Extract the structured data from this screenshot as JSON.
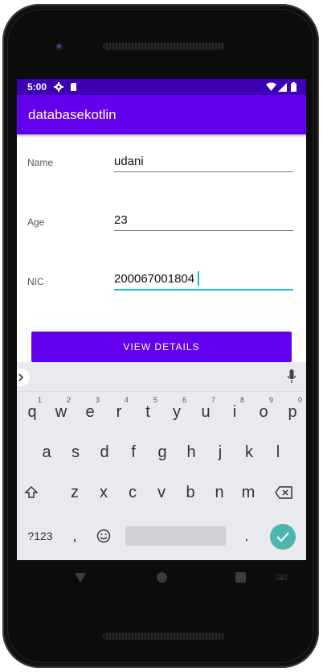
{
  "status": {
    "time": "5:00"
  },
  "app": {
    "title": "databasekotlin"
  },
  "form": {
    "name_label": "Name",
    "name_value": "udani",
    "age_label": "Age",
    "age_value": "23",
    "nic_label": "NIC",
    "nic_value": "200067001804",
    "button_label": "VIEW DETAILS"
  },
  "keyboard": {
    "row1": [
      {
        "key": "q",
        "hint": "1"
      },
      {
        "key": "w",
        "hint": "2"
      },
      {
        "key": "e",
        "hint": "3"
      },
      {
        "key": "r",
        "hint": "4"
      },
      {
        "key": "t",
        "hint": "5"
      },
      {
        "key": "y",
        "hint": "6"
      },
      {
        "key": "u",
        "hint": "7"
      },
      {
        "key": "i",
        "hint": "8"
      },
      {
        "key": "o",
        "hint": "9"
      },
      {
        "key": "p",
        "hint": "0"
      }
    ],
    "row2": [
      "a",
      "s",
      "d",
      "f",
      "g",
      "h",
      "j",
      "k",
      "l"
    ],
    "row3": [
      "z",
      "x",
      "c",
      "v",
      "b",
      "n",
      "m"
    ],
    "symbols_label": "?123",
    "comma": ",",
    "period": ".",
    "accent_color": "#4db6ac"
  },
  "colors": {
    "appbar": "#6200ee",
    "statusbar": "#3d00b3",
    "focus": "#19bcc6"
  }
}
